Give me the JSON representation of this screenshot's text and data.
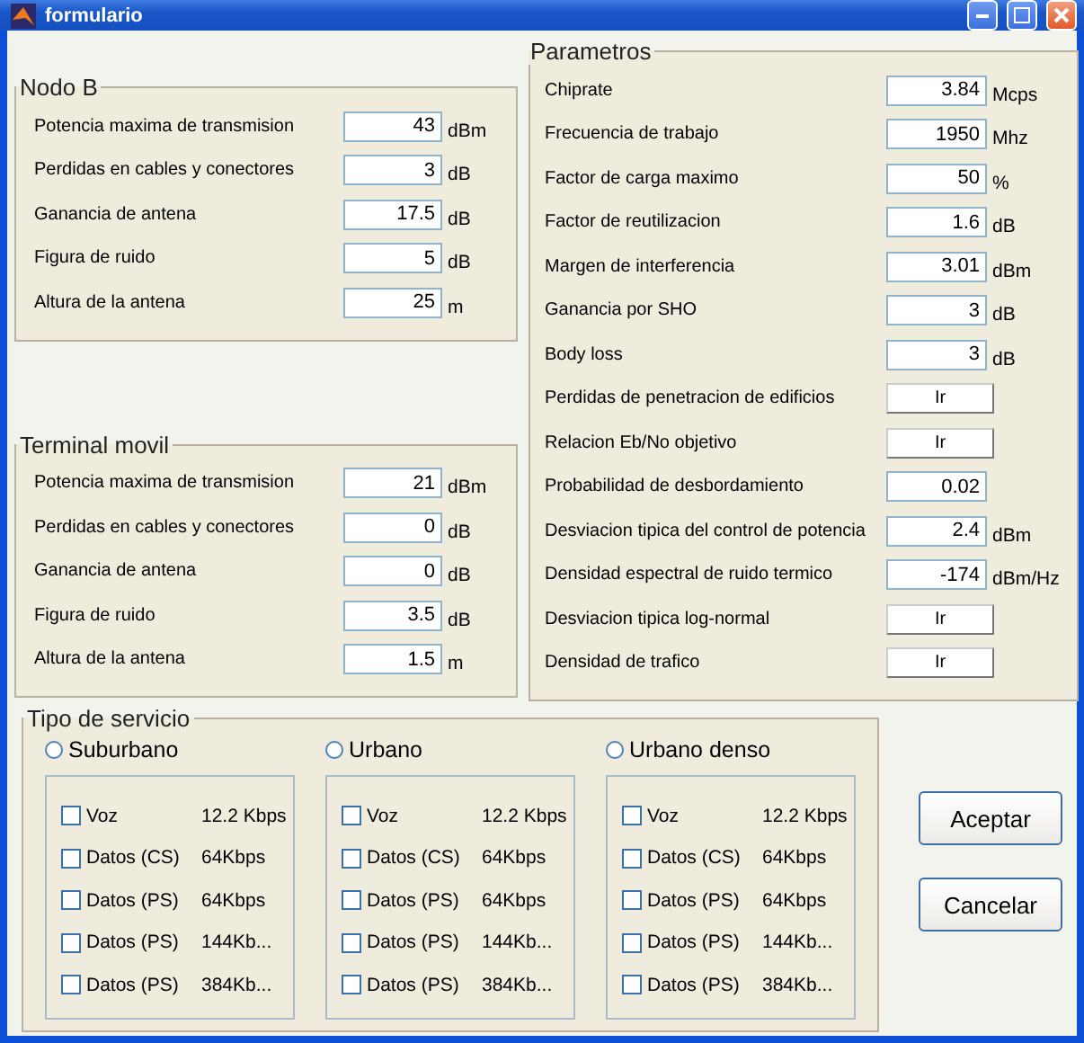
{
  "window": {
    "title": "formulario"
  },
  "nodo_b": {
    "title": "Nodo B",
    "rows": [
      {
        "label": "Potencia maxima de transmision",
        "value": "43",
        "unit": "dBm"
      },
      {
        "label": "Perdidas en cables y conectores",
        "value": "3",
        "unit": "dB"
      },
      {
        "label": "Ganancia de antena",
        "value": "17.5",
        "unit": "dB"
      },
      {
        "label": "Figura de ruido",
        "value": "5",
        "unit": "dB"
      },
      {
        "label": "Altura de la antena",
        "value": "25",
        "unit": "m"
      }
    ]
  },
  "terminal_movil": {
    "title": "Terminal movil",
    "rows": [
      {
        "label": "Potencia maxima de transmision",
        "value": "21",
        "unit": "dBm"
      },
      {
        "label": "Perdidas en cables y conectores",
        "value": "0",
        "unit": "dB"
      },
      {
        "label": "Ganancia de antena",
        "value": "0",
        "unit": "dB"
      },
      {
        "label": "Figura de ruido",
        "value": "3.5",
        "unit": "dB"
      },
      {
        "label": "Altura de la antena",
        "value": "1.5",
        "unit": "m"
      }
    ]
  },
  "parametros": {
    "title": "Parametros",
    "rows": [
      {
        "kind": "field",
        "label": "Chiprate",
        "value": "3.84",
        "unit": "Mcps"
      },
      {
        "kind": "field",
        "label": "Frecuencia de trabajo",
        "value": "1950",
        "unit": "Mhz"
      },
      {
        "kind": "field",
        "label": "Factor de carga maximo",
        "value": "50",
        "unit": "%"
      },
      {
        "kind": "field",
        "label": "Factor de reutilizacion",
        "value": "1.6",
        "unit": "dB"
      },
      {
        "kind": "field",
        "label": "Margen de interferencia",
        "value": "3.01",
        "unit": "dBm"
      },
      {
        "kind": "field",
        "label": "Ganancia por SHO",
        "value": "3",
        "unit": "dB"
      },
      {
        "kind": "field",
        "label": "Body loss",
        "value": "3",
        "unit": "dB"
      },
      {
        "kind": "button",
        "label": "Perdidas de penetracion de edificios",
        "button": "Ir"
      },
      {
        "kind": "button",
        "label": "Relacion Eb/No objetivo",
        "button": "Ir"
      },
      {
        "kind": "field",
        "label": "Probabilidad de desbordamiento",
        "value": "0.02"
      },
      {
        "kind": "field",
        "label": "Desviacion tipica del control de potencia",
        "value": "2.4",
        "unit": "dBm"
      },
      {
        "kind": "field",
        "label": "Densidad espectral de ruido termico",
        "value": "-174",
        "unit": "dBm/Hz"
      },
      {
        "kind": "button",
        "label": "Desviacion tipica log-normal",
        "button": "Ir"
      },
      {
        "kind": "button",
        "label": "Densidad de trafico",
        "button": "Ir"
      }
    ]
  },
  "tipo_de_servicio": {
    "title": "Tipo de servicio",
    "groups": [
      {
        "label": "Suburbano",
        "selected": false,
        "items": [
          {
            "name": "Voz",
            "rate": "12.2 Kbps",
            "checked": false
          },
          {
            "name": "Datos (CS)",
            "rate": "64Kbps",
            "checked": false
          },
          {
            "name": "Datos (PS)",
            "rate": "64Kbps",
            "checked": false
          },
          {
            "name": "Datos (PS)",
            "rate": "144Kb...",
            "checked": false
          },
          {
            "name": "Datos (PS)",
            "rate": "384Kb...",
            "checked": false
          }
        ]
      },
      {
        "label": "Urbano",
        "selected": false,
        "items": [
          {
            "name": "Voz",
            "rate": "12.2 Kbps",
            "checked": false
          },
          {
            "name": "Datos (CS)",
            "rate": "64Kbps",
            "checked": false
          },
          {
            "name": "Datos (PS)",
            "rate": "64Kbps",
            "checked": false
          },
          {
            "name": "Datos (PS)",
            "rate": "144Kb...",
            "checked": false
          },
          {
            "name": "Datos (PS)",
            "rate": "384Kb...",
            "checked": false
          }
        ]
      },
      {
        "label": "Urbano denso",
        "selected": false,
        "items": [
          {
            "name": "Voz",
            "rate": "12.2 Kbps",
            "checked": false
          },
          {
            "name": "Datos (CS)",
            "rate": "64Kbps",
            "checked": false
          },
          {
            "name": "Datos (PS)",
            "rate": "64Kbps",
            "checked": false
          },
          {
            "name": "Datos (PS)",
            "rate": "144Kb...",
            "checked": false
          },
          {
            "name": "Datos (PS)",
            "rate": "384Kb...",
            "checked": false
          }
        ]
      }
    ]
  },
  "buttons": [
    "Aceptar",
    "Cancelar"
  ]
}
